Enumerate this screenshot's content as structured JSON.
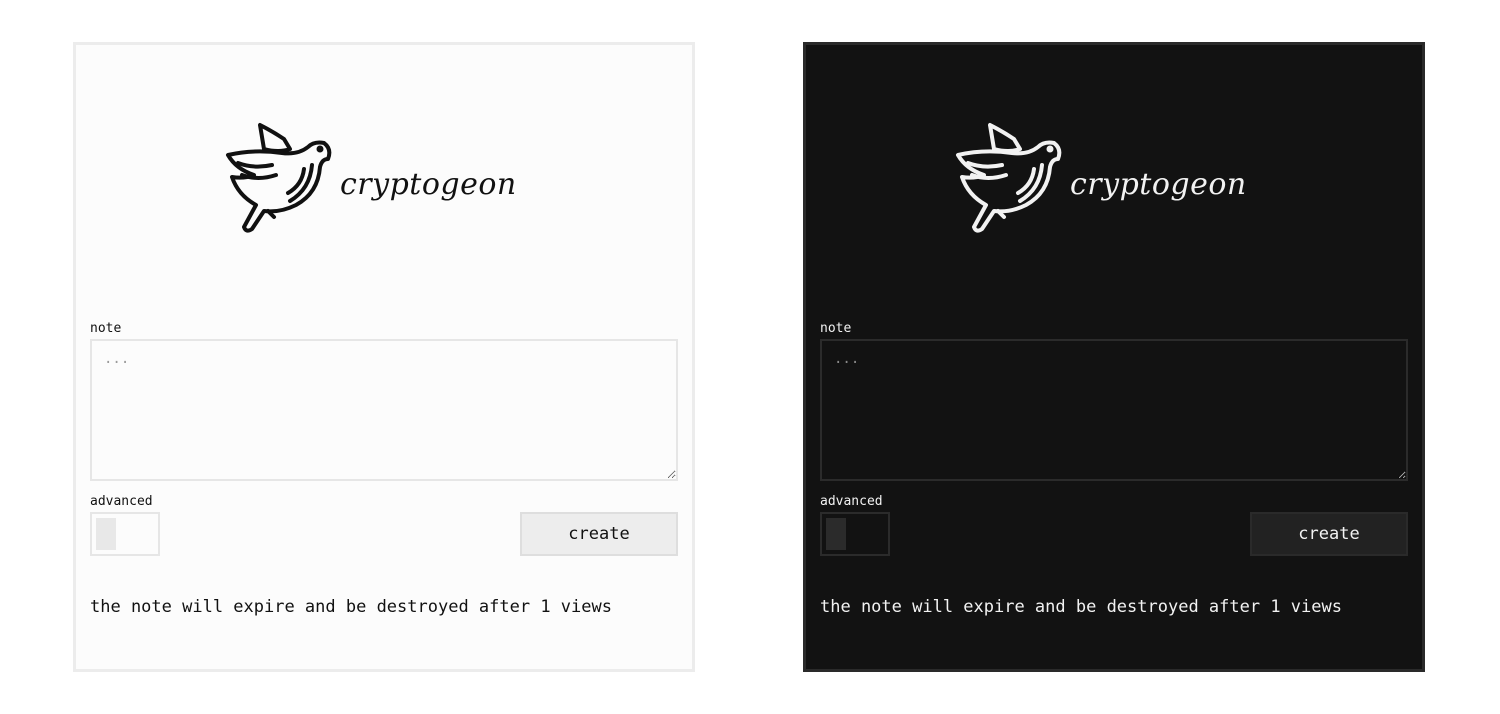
{
  "panels": [
    {
      "theme": "light",
      "brand": "cryptogeon",
      "note_label": "note",
      "note_placeholder": "...",
      "advanced_label": "advanced",
      "advanced_enabled": false,
      "create_label": "create",
      "expire_text": "the note will expire and be destroyed after 1 views"
    },
    {
      "theme": "dark",
      "brand": "cryptogeon",
      "note_label": "note",
      "note_placeholder": "...",
      "advanced_label": "advanced",
      "advanced_enabled": false,
      "create_label": "create",
      "expire_text": "the note will expire and be destroyed after 1 views"
    }
  ],
  "colors": {
    "light_bg": "#fcfcfc",
    "light_border": "#ececec",
    "dark_bg": "#121212",
    "dark_border": "#2a2a2a"
  },
  "icons": {
    "logo": "pigeon-icon"
  }
}
